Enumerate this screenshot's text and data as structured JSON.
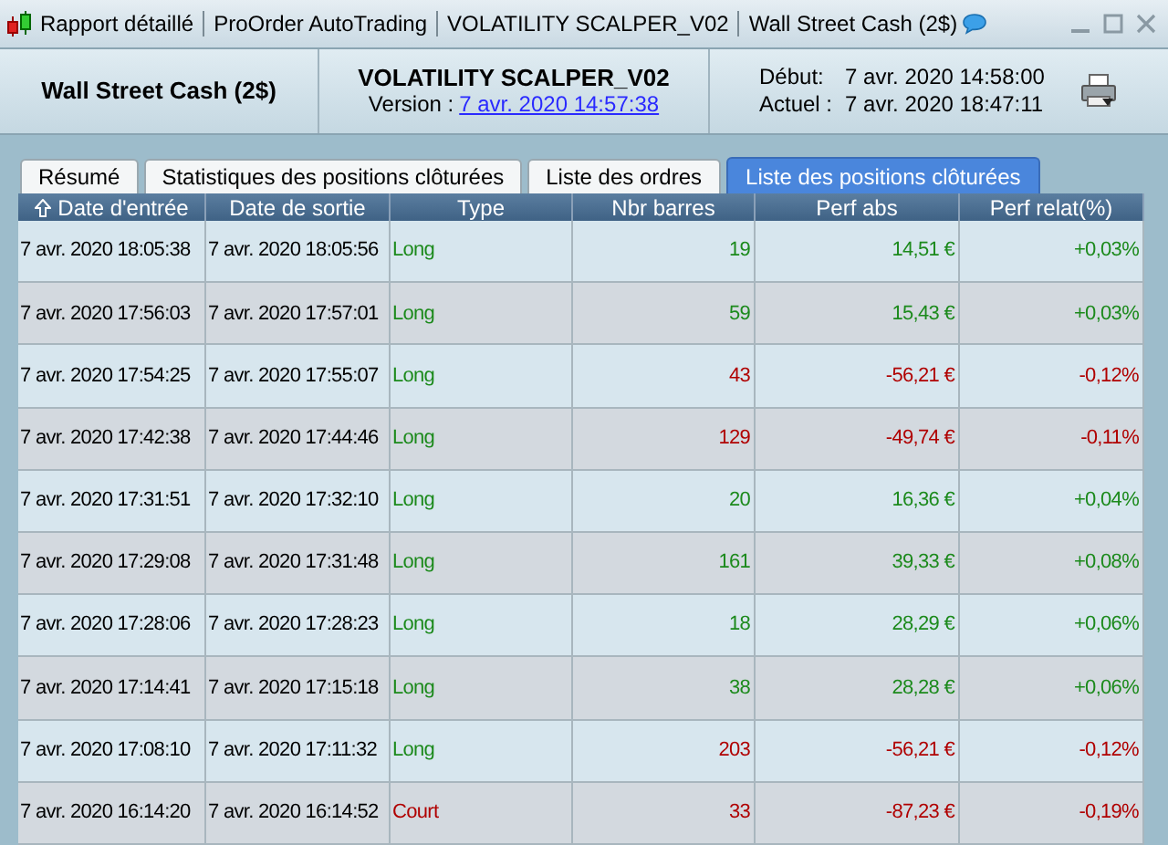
{
  "window": {
    "title_parts": [
      "Rapport détaillé",
      "ProOrder AutoTrading",
      "VOLATILITY SCALPER_V02",
      "Wall Street Cash (2$)"
    ]
  },
  "header": {
    "instrument": "Wall Street Cash (2$)",
    "strategy": "VOLATILITY SCALPER_V02",
    "version_label": "Version :",
    "version_link": "7 avr. 2020 14:57:38",
    "start_label": "Début:",
    "start_value": "7 avr. 2020 14:58:00",
    "current_label": "Actuel :",
    "current_value": "7 avr. 2020 18:47:11"
  },
  "tabs": [
    {
      "label": "Résumé",
      "selected": false
    },
    {
      "label": "Statistiques des positions clôturées",
      "selected": false
    },
    {
      "label": "Liste des ordres",
      "selected": false
    },
    {
      "label": "Liste des positions clôturées",
      "selected": true
    }
  ],
  "table": {
    "columns": [
      {
        "label": "Date d'entrée",
        "sorted": true
      },
      {
        "label": "Date de sortie",
        "sorted": false
      },
      {
        "label": "Type",
        "sorted": false
      },
      {
        "label": "Nbr barres",
        "sorted": false
      },
      {
        "label": "Perf abs",
        "sorted": false
      },
      {
        "label": "Perf relat(%)",
        "sorted": false
      }
    ],
    "rows": [
      {
        "entry": "7 avr. 2020 18:05:38",
        "exit": "7 avr. 2020 18:05:56",
        "type": "Long",
        "kind": "long",
        "bars": "19",
        "perf_abs": "14,51 €",
        "perf_rel": "+0,03%",
        "gain": true
      },
      {
        "entry": "7 avr. 2020 17:56:03",
        "exit": "7 avr. 2020 17:57:01",
        "type": "Long",
        "kind": "long",
        "bars": "59",
        "perf_abs": "15,43 €",
        "perf_rel": "+0,03%",
        "gain": true
      },
      {
        "entry": "7 avr. 2020 17:54:25",
        "exit": "7 avr. 2020 17:55:07",
        "type": "Long",
        "kind": "long",
        "bars": "43",
        "perf_abs": "-56,21 €",
        "perf_rel": "-0,12%",
        "gain": false
      },
      {
        "entry": "7 avr. 2020 17:42:38",
        "exit": "7 avr. 2020 17:44:46",
        "type": "Long",
        "kind": "long",
        "bars": "129",
        "perf_abs": "-49,74 €",
        "perf_rel": "-0,11%",
        "gain": false
      },
      {
        "entry": "7 avr. 2020 17:31:51",
        "exit": "7 avr. 2020 17:32:10",
        "type": "Long",
        "kind": "long",
        "bars": "20",
        "perf_abs": "16,36 €",
        "perf_rel": "+0,04%",
        "gain": true
      },
      {
        "entry": "7 avr. 2020 17:29:08",
        "exit": "7 avr. 2020 17:31:48",
        "type": "Long",
        "kind": "long",
        "bars": "161",
        "perf_abs": "39,33 €",
        "perf_rel": "+0,08%",
        "gain": true
      },
      {
        "entry": "7 avr. 2020 17:28:06",
        "exit": "7 avr. 2020 17:28:23",
        "type": "Long",
        "kind": "long",
        "bars": "18",
        "perf_abs": "28,29 €",
        "perf_rel": "+0,06%",
        "gain": true
      },
      {
        "entry": "7 avr. 2020 17:14:41",
        "exit": "7 avr. 2020 17:15:18",
        "type": "Long",
        "kind": "long",
        "bars": "38",
        "perf_abs": "28,28 €",
        "perf_rel": "+0,06%",
        "gain": true
      },
      {
        "entry": "7 avr. 2020 17:08:10",
        "exit": "7 avr. 2020 17:11:32",
        "type": "Long",
        "kind": "long",
        "bars": "203",
        "perf_abs": "-56,21 €",
        "perf_rel": "-0,12%",
        "gain": false
      },
      {
        "entry": "7 avr. 2020 16:14:20",
        "exit": "7 avr. 2020 16:14:52",
        "type": "Court",
        "kind": "short",
        "bars": "33",
        "perf_abs": "-87,23 €",
        "perf_rel": "-0,19%",
        "gain": false
      }
    ]
  }
}
